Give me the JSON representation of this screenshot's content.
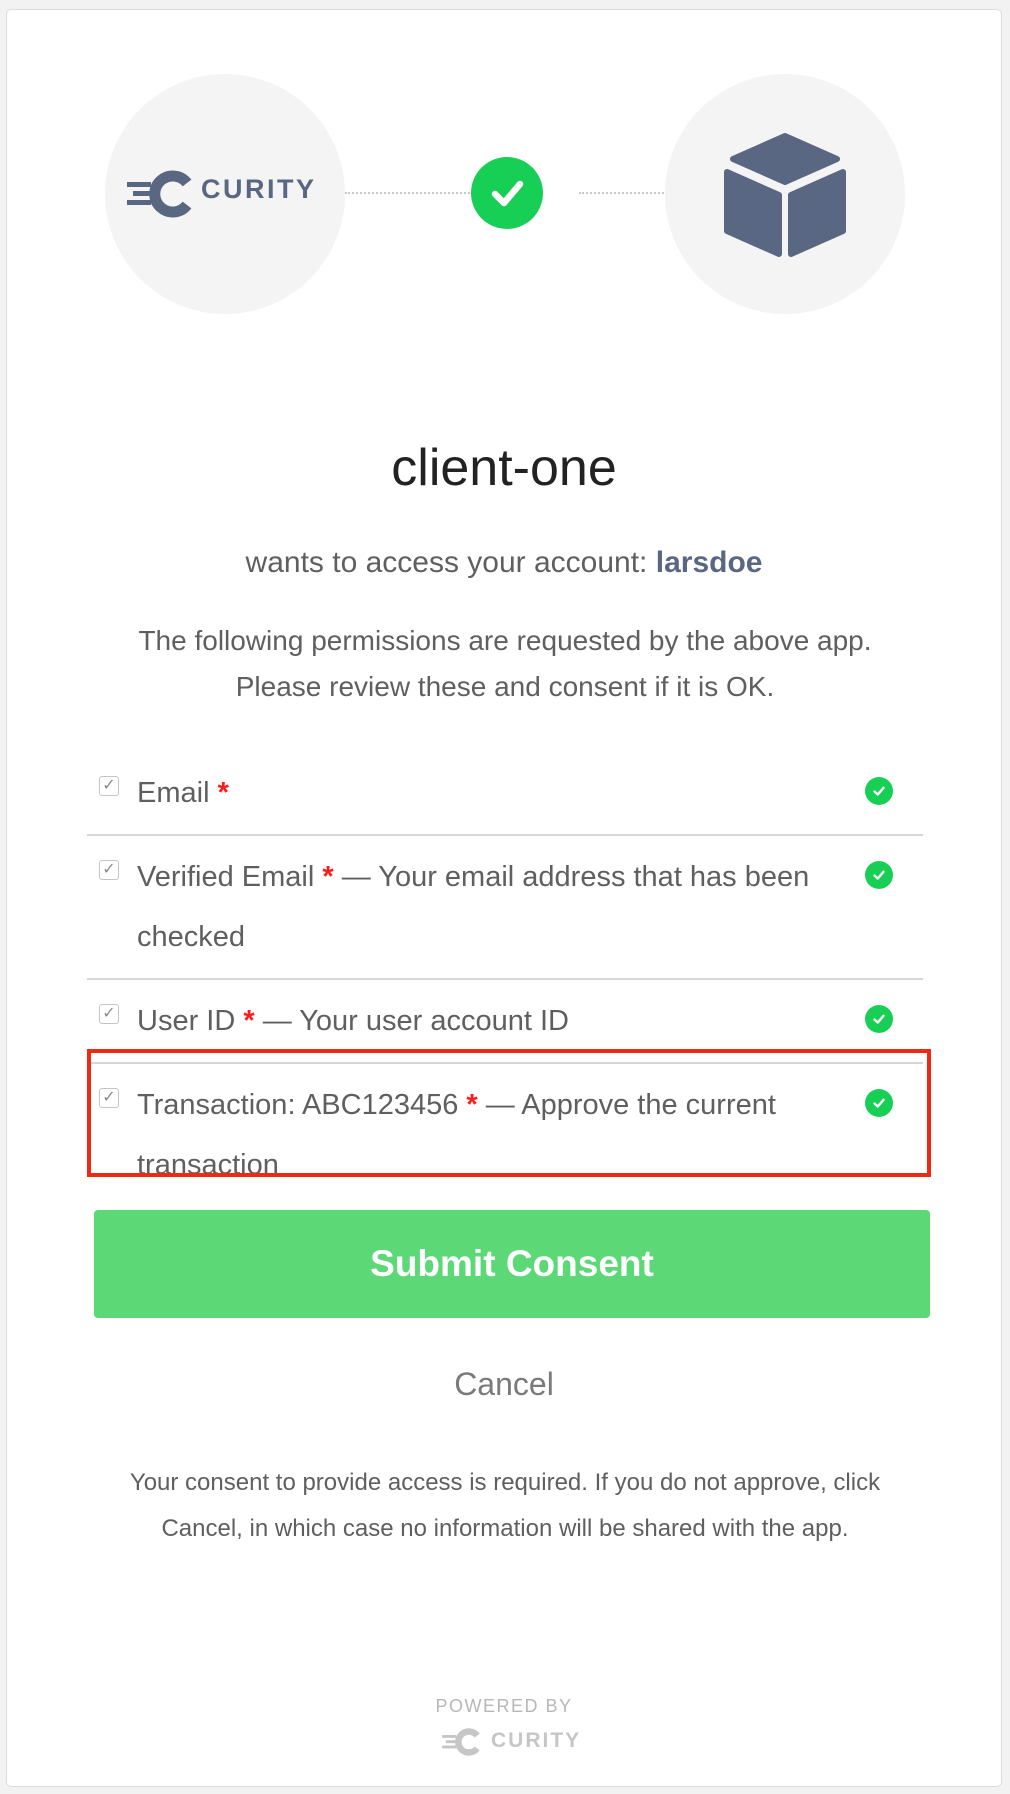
{
  "header": {
    "left_logo": {
      "icon": "curity-logo-icon",
      "wordmark": "CURITY"
    },
    "status_icon": "check-circle-icon",
    "right_logo": {
      "icon": "cube-icon"
    }
  },
  "consent": {
    "client_name": "client-one",
    "subtitle_prefix": "wants to access your account:",
    "account": "larsdoe",
    "intro_line1": "The following permissions are requested by the above app.",
    "intro_line2": "Please review these and consent if it is OK."
  },
  "scopes": [
    {
      "label": "Email",
      "required_mark": "*",
      "description": "",
      "checked": true,
      "status_icon": "check-circle-icon"
    },
    {
      "label": "Verified Email",
      "required_mark": "*",
      "description": " — Your email address that has been checked",
      "checked": true,
      "status_icon": "check-circle-icon"
    },
    {
      "label": "User ID",
      "required_mark": "*",
      "description": " — Your user account ID",
      "checked": true,
      "status_icon": "check-circle-icon"
    },
    {
      "label": "Transaction: ABC123456",
      "required_mark": "*",
      "description": " — Approve the current transaction",
      "checked": true,
      "status_icon": "check-circle-icon"
    }
  ],
  "actions": {
    "submit_label": "Submit Consent",
    "cancel_label": "Cancel"
  },
  "notice": "Your consent to provide access is required. If you do not approve, click Cancel, in which case no information will be shared with the app.",
  "footer": {
    "powered_by": "POWERED BY",
    "brand": "CURITY"
  },
  "colors": {
    "accent_green": "#5cd877",
    "check_green": "#17cf54",
    "brand_slate": "#5a6782",
    "required_red": "#ff1a1a",
    "highlight_red": "#ef2a14"
  }
}
